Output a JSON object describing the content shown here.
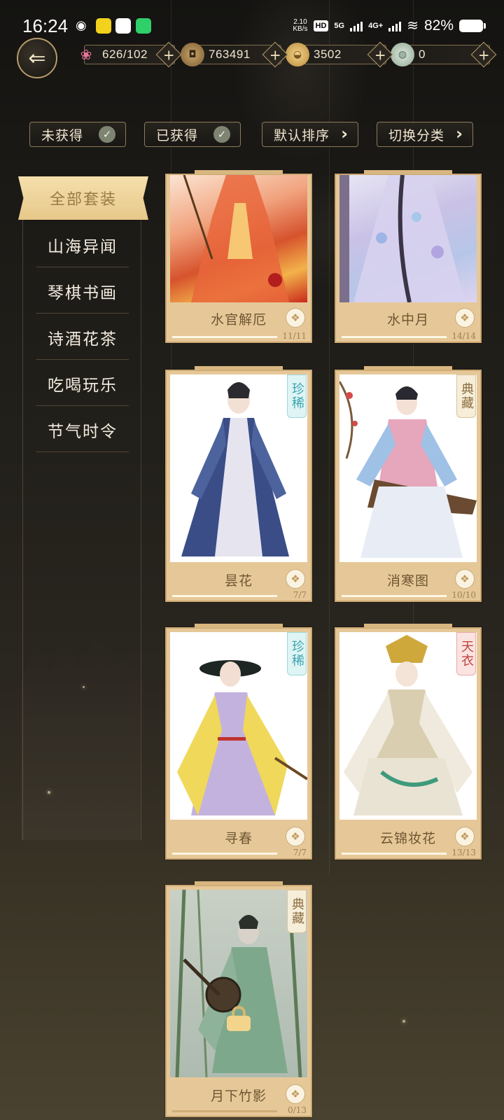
{
  "status_bar": {
    "time": "16:24",
    "net_speed": "2.10",
    "net_unit": "KB/s",
    "hd": "HD",
    "sim1": "5G",
    "sim2": "4G+",
    "battery": "82%"
  },
  "resources": [
    {
      "icon": "lotus-icon",
      "value": "626/102"
    },
    {
      "icon": "copper-coin-icon",
      "value": "763491"
    },
    {
      "icon": "gold-ingot-icon",
      "value": "3502"
    },
    {
      "icon": "jade-icon",
      "value": "0"
    }
  ],
  "filters": [
    {
      "label": "未获得",
      "type": "check"
    },
    {
      "label": "已获得",
      "type": "check"
    },
    {
      "label": "默认排序",
      "type": "arrow"
    },
    {
      "label": "切换分类",
      "type": "arrow"
    }
  ],
  "sidebar": {
    "active": "全部套装",
    "items": [
      "山海异闻",
      "琴棋书画",
      "诗酒花茶",
      "吃喝玩乐",
      "节气时令"
    ]
  },
  "outfits": [
    {
      "name": "水官解厄",
      "count": "11/11",
      "progress": 1.0,
      "rarity": ""
    },
    {
      "name": "水中月",
      "count": "14/14",
      "progress": 1.0,
      "rarity": ""
    },
    {
      "name": "昙花",
      "count": "7/7",
      "progress": 1.0,
      "rarity": "珍稀"
    },
    {
      "name": "消寒图",
      "count": "10/10",
      "progress": 1.0,
      "rarity": "典藏"
    },
    {
      "name": "寻春",
      "count": "7/7",
      "progress": 1.0,
      "rarity": "珍稀"
    },
    {
      "name": "云锦妆花",
      "count": "13/13",
      "progress": 1.0,
      "rarity": "天衣"
    },
    {
      "name": "月下竹影",
      "count": "0/13",
      "progress": 0.0,
      "rarity": "典藏",
      "locked": true
    }
  ],
  "colors": {
    "card_bg": "#e6c898",
    "active_tab": "#f5dfab",
    "rare_badge": "#3aa4b0",
    "classic_badge": "#8a6b3d",
    "heaven_badge": "#c0453f"
  }
}
